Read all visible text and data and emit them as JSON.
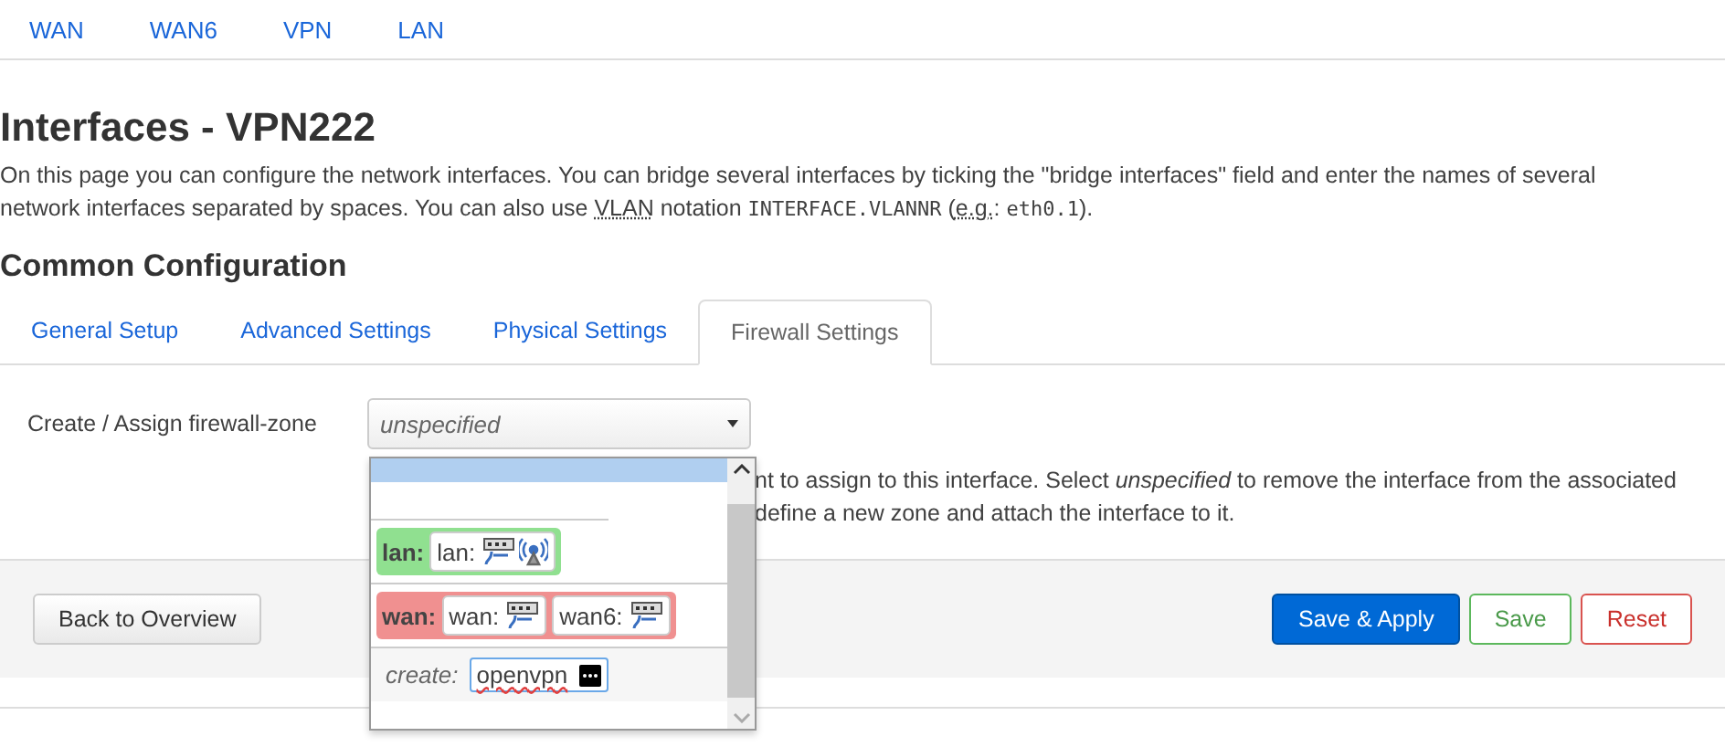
{
  "nav_tabs": [
    {
      "label": "WAN",
      "selected": false
    },
    {
      "label": "WAN6",
      "selected": false
    },
    {
      "label": "VPN",
      "selected": false
    },
    {
      "label": "LAN",
      "selected": false
    }
  ],
  "title": "Interfaces - VPN222",
  "intro": [
    {
      "kind": "text",
      "text": "On this page you can configure the network interfaces. You can bridge several interfaces by ticking the \"bridge interfaces\" field and enter the names of several network interfaces separated by spaces. You can also use "
    },
    {
      "kind": "abbr",
      "text": "VLAN"
    },
    {
      "kind": "text",
      "text": " notation "
    },
    {
      "kind": "code",
      "text": "INTERFACE.VLANNR"
    },
    {
      "kind": "text",
      "text": " ("
    },
    {
      "kind": "abbr",
      "text": "e.g."
    },
    {
      "kind": "text",
      "text": ": "
    },
    {
      "kind": "code",
      "text": "eth0.1"
    },
    {
      "kind": "text",
      "text": ")."
    }
  ],
  "section_title": "Common Configuration",
  "section_tabs": [
    {
      "label": "General Setup",
      "selected": false
    },
    {
      "label": "Advanced Settings",
      "selected": false
    },
    {
      "label": "Physical Settings",
      "selected": false
    },
    {
      "label": "Firewall Settings",
      "selected": true
    }
  ],
  "field": {
    "label": "Create / Assign firewall-zone",
    "value": "unspecified",
    "description": [
      "nt to assign to this interface. Select *unspecified* to remove the interface from the associated",
      "define a new zone and attach the interface to it."
    ]
  },
  "dropdown": {
    "options": [
      {
        "kind": "selected-blank"
      },
      {
        "kind": "blank"
      },
      {
        "kind": "zone",
        "name": "lan:",
        "color": "#90e090",
        "networks": [
          {
            "name": "lan:",
            "devices": [
              {
                "kind": "ethernet"
              },
              {
                "kind": "wireless"
              }
            ]
          }
        ]
      },
      {
        "kind": "zone",
        "name": "wan:",
        "color": "#f09090",
        "networks": [
          {
            "name": "wan:",
            "devices": [
              {
                "kind": "ethernet"
              }
            ]
          },
          {
            "name": "wan6:",
            "devices": [
              {
                "kind": "ethernet"
              }
            ]
          }
        ]
      },
      {
        "kind": "create",
        "label": "create:",
        "value": "openvpn"
      }
    ]
  },
  "buttons": [
    {
      "label": "Back to Overview",
      "kind": "default"
    },
    {
      "label": "Save & Apply",
      "kind": "primary"
    },
    {
      "label": "Save",
      "kind": "positive"
    },
    {
      "label": "Reset",
      "kind": "negative"
    }
  ]
}
